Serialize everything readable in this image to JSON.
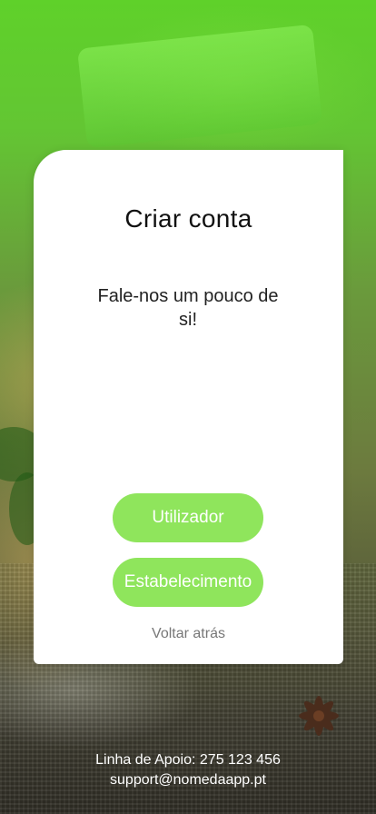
{
  "card": {
    "title": "Criar conta",
    "subtitle": "Fale-nos um pouco de si!",
    "buttons": {
      "user": "Utilizador",
      "establishment": "Estabelecimento"
    },
    "back_link": "Voltar atrás"
  },
  "footer": {
    "support_line": "Linha de Apoio: 275 123 456",
    "support_email": "support@nomedaapp.pt"
  },
  "colors": {
    "accent": "#8fe55c",
    "card_bg": "#ffffff",
    "link": "#777777"
  }
}
